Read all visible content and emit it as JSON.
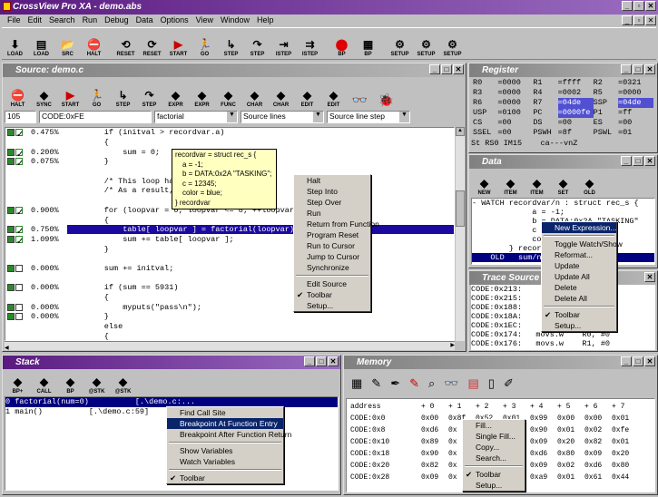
{
  "app_title": "CrossView Pro XA - demo.abs",
  "menu": [
    "File",
    "Edit",
    "Search",
    "Run",
    "Debug",
    "Data",
    "Options",
    "View",
    "Window",
    "Help"
  ],
  "main_toolbar": [
    {
      "label": "LOAD",
      "icon": "load-icon"
    },
    {
      "label": "LOAD",
      "icon": "load-file-icon"
    },
    {
      "label": "SRC",
      "icon": "open-source-icon"
    },
    {
      "label": "HALT",
      "icon": "halt-icon"
    },
    {
      "label": "RESET",
      "icon": "reset-icon"
    },
    {
      "label": "RESET",
      "icon": "reset-start-icon"
    },
    {
      "label": "START",
      "icon": "start-icon"
    },
    {
      "label": "GO",
      "icon": "go-icon"
    },
    {
      "label": "STEP",
      "icon": "step-icon"
    },
    {
      "label": "STEP",
      "icon": "step-over-icon"
    },
    {
      "label": "ISTEP",
      "icon": "istep-icon"
    },
    {
      "label": "ISTEP",
      "icon": "istep-over-icon"
    },
    {
      "label": "BP",
      "icon": "breakpoint-icon"
    },
    {
      "label": "BP",
      "icon": "bp-list-icon"
    },
    {
      "label": "SETUP",
      "icon": "setup-src-icon"
    },
    {
      "label": "SETUP",
      "icon": "setup-icon"
    },
    {
      "label": "SETUP",
      "icon": "setup-csv-icon"
    }
  ],
  "source": {
    "title": "Source: demo.c",
    "toolbar": [
      "HALT",
      "SYNC",
      "START",
      "GO",
      "STEP",
      "STEP",
      "EXPR",
      "EXPR",
      "FUNC",
      "CHAR",
      "CHAR",
      "EDIT",
      "EDIT"
    ],
    "line_no": "105",
    "address": "CODE:0xFE",
    "function": "factorial",
    "view_mode": "Source lines",
    "step_mode": "Source line step",
    "lines": [
      {
        "pct": "0.475%",
        "code": "        if (initval > recordvar.a)",
        "mark": "gg"
      },
      {
        "pct": "",
        "code": "        {",
        "mark": ""
      },
      {
        "pct": "0.200%",
        "code": "            sum = 0;",
        "mark": "gg"
      },
      {
        "pct": "0.075%",
        "code": "        }",
        "mark": "gg"
      },
      {
        "pct": "",
        "code": "",
        "mark": ""
      },
      {
        "pct": "",
        "code": "        /* This loop has an                          too l",
        "mark": ""
      },
      {
        "pct": "",
        "code": "        /* As a result, init                         d.",
        "mark": ""
      },
      {
        "pct": "",
        "code": "",
        "mark": ""
      },
      {
        "pct": "0.900%",
        "code": "        for (loopvar = 0; loopvar <= 8; ++loopvar)",
        "mark": "gg"
      },
      {
        "pct": "",
        "code": "        {",
        "mark": ""
      },
      {
        "pct": "0.750%",
        "code": "            table[ loopvar ] = factorial(loopvar);",
        "mark": "gg",
        "hl": true
      },
      {
        "pct": "1.099%",
        "code": "            sum += table[ loopvar ];",
        "mark": "gg"
      },
      {
        "pct": "",
        "code": "        }",
        "mark": ""
      },
      {
        "pct": "",
        "code": "",
        "mark": ""
      },
      {
        "pct": "0.000%",
        "code": "        sum += initval;",
        "mark": "g"
      },
      {
        "pct": "",
        "code": "",
        "mark": ""
      },
      {
        "pct": "0.000%",
        "code": "        if (sum == 5931)",
        "mark": "g"
      },
      {
        "pct": "",
        "code": "        {",
        "mark": ""
      },
      {
        "pct": "0.000%",
        "code": "            myputs(\"pass\\n\");",
        "mark": "g"
      },
      {
        "pct": "0.000%",
        "code": "        }",
        "mark": "g"
      },
      {
        "pct": "",
        "code": "        else",
        "mark": ""
      },
      {
        "pct": "",
        "code": "        {",
        "mark": ""
      }
    ],
    "tooltip": [
      "recordvar = struct rec_s {",
      "a = -1;",
      "b = DATA:0x2A \"TASKING\";",
      "c = 12345;",
      "color = blue;",
      "} recordvar"
    ],
    "context_menu": [
      {
        "label": "Halt"
      },
      {
        "label": "Step Into"
      },
      {
        "label": "Step Over"
      },
      {
        "label": "Run"
      },
      {
        "label": "Return from Function"
      },
      {
        "label": "Program Reset"
      },
      {
        "label": "Run to Cursor"
      },
      {
        "label": "Jump to Cursor"
      },
      {
        "label": "Synchronize"
      },
      {
        "sep": true
      },
      {
        "label": "Edit Source"
      },
      {
        "label": "Toolbar",
        "checked": true
      },
      {
        "label": "Setup..."
      }
    ]
  },
  "register": {
    "title": "Register",
    "rows": [
      [
        "R0",
        "=0000",
        "R1",
        "=ffff",
        "R2",
        "=0321"
      ],
      [
        "R3",
        "=0000",
        "R4",
        "=0002",
        "R5",
        "=0000"
      ],
      [
        "R6",
        "=0000",
        "R7",
        "=04de",
        "SSP",
        "=04de"
      ],
      [
        "USP",
        "=0100",
        "PC",
        "=0000fe",
        "P1",
        "=ff"
      ],
      [
        "CS",
        "=00",
        "DS",
        "=00",
        "ES",
        "=00"
      ],
      [
        "SSEL",
        "=00",
        "PSWH",
        "=8f",
        "PSWL",
        "=01"
      ]
    ],
    "status": "St RS0 IM15    ca---vnZ"
  },
  "data": {
    "title": "Data",
    "toolbar": [
      "NEW",
      "ITEM",
      "ITEM",
      "SET",
      "OLD"
    ],
    "lines": [
      "- WATCH recordvar/n : struct rec_s {",
      "             a = -1;",
      "             b = DATA:0x2A \"TASKING\"",
      "             c =",
      "             col",
      "        } recor",
      "    OLD   sum/n :"
    ],
    "context_menu": [
      {
        "label": "New Expression...",
        "sel": true
      },
      {
        "sep": true
      },
      {
        "label": "Toggle Watch/Show"
      },
      {
        "label": "Reformat..."
      },
      {
        "label": "Update"
      },
      {
        "label": "Update All"
      },
      {
        "label": "Delete"
      },
      {
        "label": "Delete All"
      },
      {
        "sep": true
      },
      {
        "label": "Toolbar",
        "checked": true
      },
      {
        "label": "Setup..."
      }
    ]
  },
  "trace": {
    "title": "Trace Source",
    "lines": [
      "CODE:0x213:",
      "CODE:0x215:",
      "CODE:0x188:",
      "CODE:0x18A:",
      "CODE:0x1EC:",
      "CODE:0x174:   movs.w    R0, #0",
      "CODE:0x176:   movs.w    R1, #0"
    ]
  },
  "stack": {
    "title": "Stack",
    "toolbar": [
      "BP+",
      "CALL",
      "BP",
      "@STK",
      "@STK"
    ],
    "rows": [
      {
        "text": "0 factorial(num=0)          [.\\demo.c:...",
        "sel": true
      },
      {
        "text": "1 main()          [.\\demo.c:59]",
        "sel": false
      }
    ],
    "context_menu": [
      {
        "label": "Find Call Site"
      },
      {
        "label": "Breakpoint At Function Entry",
        "sel": true
      },
      {
        "label": "Breakpoint After Function Return"
      },
      {
        "sep": true
      },
      {
        "label": "Show Variables"
      },
      {
        "label": "Watch Variables"
      },
      {
        "sep": true
      },
      {
        "label": "Toolbar",
        "checked": true
      }
    ]
  },
  "memory": {
    "title": "Memory",
    "header": [
      "address",
      "+ 0",
      "+ 1",
      "+ 2",
      "+ 3",
      "+ 4",
      "+ 5",
      "+ 6",
      "+ 7"
    ],
    "rows": [
      [
        "CODE:0x0",
        "0x00",
        "0x8f",
        "0x52",
        "0x01",
        "0x99",
        "0x00",
        "0x00",
        "0x01"
      ],
      [
        "CODE:0x8",
        "0xd6",
        "0x",
        "",
        "",
        "0x90",
        "0x01",
        "0x02",
        "0xfe"
      ],
      [
        "CODE:0x10",
        "0x89",
        "0x",
        "",
        "",
        "0x09",
        "0x20",
        "0x82",
        "0x01"
      ],
      [
        "CODE:0x18",
        "0x90",
        "0x",
        "",
        "",
        "0xd6",
        "0x80",
        "0x09",
        "0x20"
      ],
      [
        "CODE:0x20",
        "0x82",
        "0x",
        "",
        "",
        "0x09",
        "0x02",
        "0xd6",
        "0x80"
      ],
      [
        "CODE:0x28",
        "0x09",
        "0x",
        "",
        "",
        "0xa9",
        "0x01",
        "0x61",
        "0x44"
      ]
    ],
    "context_menu": [
      {
        "label": "Fill..."
      },
      {
        "label": "Single Fill..."
      },
      {
        "label": "Copy..."
      },
      {
        "label": "Search..."
      },
      {
        "sep": true
      },
      {
        "label": "Toolbar",
        "checked": true
      },
      {
        "label": "Setup..."
      }
    ]
  },
  "colors": {
    "title_active": "#5a1a80",
    "highlight_row": "#1a0aa0",
    "reg_highlight": "#5050d0"
  }
}
